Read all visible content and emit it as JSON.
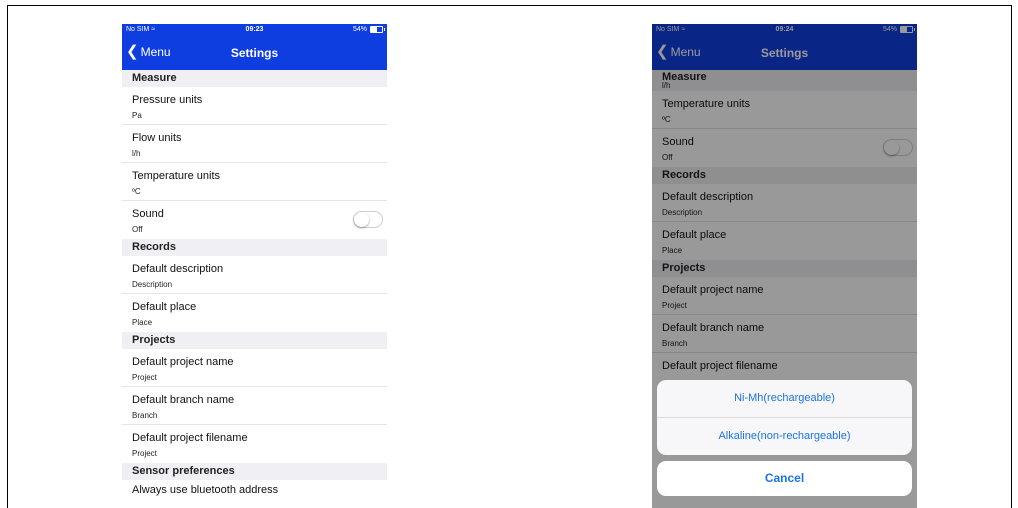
{
  "screen1": {
    "status": {
      "carrier": "No SIM",
      "time": "09:23",
      "battery": "54%"
    },
    "nav": {
      "back_label": "Menu",
      "title": "Settings"
    },
    "sections": {
      "measure": "Measure",
      "records": "Records",
      "projects": "Projects",
      "sensor": "Sensor preferences"
    },
    "rows": {
      "pressure": {
        "label": "Pressure units",
        "value": "Pa"
      },
      "flow": {
        "label": "Flow units",
        "value": "l/h"
      },
      "temperature": {
        "label": "Temperature units",
        "value": "ºC"
      },
      "sound": {
        "label": "Sound",
        "value": "Off",
        "toggle_on": false
      },
      "description": {
        "label": "Default description",
        "value": "Description"
      },
      "place": {
        "label": "Default place",
        "value": "Place"
      },
      "project_name": {
        "label": "Default project name",
        "value": "Project"
      },
      "branch_name": {
        "label": "Default branch name",
        "value": "Branch"
      },
      "project_filename": {
        "label": "Default project filename",
        "value": "Project"
      },
      "bluetooth": {
        "label": "Always use bluetooth address"
      }
    }
  },
  "screen2": {
    "status": {
      "carrier": "No SIM",
      "time": "09:24",
      "battery": "54%"
    },
    "nav": {
      "back_label": "Menu",
      "title": "Settings"
    },
    "sections": {
      "measure": "Measure",
      "records": "Records",
      "projects": "Projects"
    },
    "rows": {
      "flow_value": "l/h",
      "temperature": {
        "label": "Temperature units",
        "value": "ºC"
      },
      "sound": {
        "label": "Sound",
        "value": "Off",
        "toggle_on": false
      },
      "description": {
        "label": "Default description",
        "value": "Description"
      },
      "place": {
        "label": "Default place",
        "value": "Place"
      },
      "project_name": {
        "label": "Default project name",
        "value": "Project"
      },
      "branch_name": {
        "label": "Default branch name",
        "value": "Branch"
      },
      "project_filename": {
        "label": "Default project filename"
      }
    },
    "action_sheet": {
      "options": [
        "Ni-Mh(rechargeable)",
        "Alkaline(non-rechargeable)"
      ],
      "cancel": "Cancel"
    }
  },
  "colors": {
    "nav_bar": "#0f3ee0",
    "accent": "#1a73e8",
    "section_bg": "#efeff4"
  }
}
